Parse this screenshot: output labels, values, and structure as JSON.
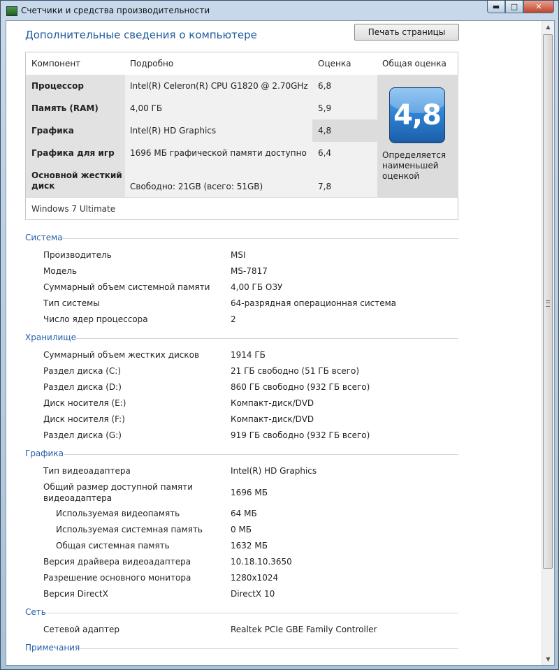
{
  "window": {
    "title": "Счетчики и средства производительности",
    "minimize": "▬",
    "maximize": "□",
    "close": "✕"
  },
  "page": {
    "heading": "Дополнительные сведения о компьютере",
    "print_button": "Печать страницы"
  },
  "score_table": {
    "headers": {
      "component": "Компонент",
      "details": "Подробно",
      "score": "Оценка",
      "base": "Общая оценка"
    },
    "rows": [
      {
        "component": "Процессор",
        "details": "Intel(R) Celeron(R) CPU G1820 @ 2.70GHz",
        "score": "6,8"
      },
      {
        "component": "Память (RAM)",
        "details": "4,00 ГБ",
        "score": "5,9"
      },
      {
        "component": "Графика",
        "details": "Intel(R) HD Graphics",
        "score": "4,8"
      },
      {
        "component": "Графика для игр",
        "details": "1696 МБ графической памяти доступно",
        "score": "6,4"
      },
      {
        "component": "Основной жесткий диск",
        "details": "Свободно: 21GB (всего: 51GB)",
        "score": "7,8"
      }
    ],
    "base_score": "4,8",
    "base_caption": "Определяется наименьшей оценкой",
    "os": "Windows 7 Ultimate"
  },
  "sections": {
    "system": {
      "title": "Система",
      "items": [
        {
          "label": "Производитель",
          "value": "MSI"
        },
        {
          "label": "Модель",
          "value": "MS-7817"
        },
        {
          "label": "Суммарный объем системной памяти",
          "value": "4,00 ГБ ОЗУ"
        },
        {
          "label": "Тип системы",
          "value": "64-разрядная операционная система"
        },
        {
          "label": "Число ядер процессора",
          "value": "2"
        }
      ]
    },
    "storage": {
      "title": "Хранилище",
      "items": [
        {
          "label": "Суммарный объем жестких дисков",
          "value": "1914 ГБ"
        },
        {
          "label": "Раздел диска (C:)",
          "value": "21 ГБ свободно (51 ГБ всего)"
        },
        {
          "label": "Раздел диска (D:)",
          "value": "860 ГБ свободно (932 ГБ всего)"
        },
        {
          "label": "Диск носителя (E:)",
          "value": "Компакт-диск/DVD"
        },
        {
          "label": "Диск носителя (F:)",
          "value": "Компакт-диск/DVD"
        },
        {
          "label": "Раздел диска (G:)",
          "value": "919 ГБ свободно (932 ГБ всего)"
        }
      ]
    },
    "graphics": {
      "title": "Графика",
      "adapter_type": {
        "label": "Тип видеоадаптера",
        "value": "Intel(R) HD Graphics"
      },
      "total_memory": {
        "label_line1": "Общий размер доступной памяти",
        "label_line2": "видеоадаптера",
        "value": "1696 МБ"
      },
      "sub_items": [
        {
          "label": "Используемая видеопамять",
          "value": "64 МБ"
        },
        {
          "label": "Используемая системная память",
          "value": "0 МБ"
        },
        {
          "label": "Общая системная память",
          "value": "1632 МБ"
        }
      ],
      "items": [
        {
          "label": "Версия драйвера видеоадаптера",
          "value": "10.18.10.3650"
        },
        {
          "label": "Разрешение основного монитора",
          "value": "1280x1024"
        },
        {
          "label": "Версия DirectX",
          "value": "DirectX 10"
        }
      ]
    },
    "network": {
      "title": "Сеть",
      "items": [
        {
          "label": "Сетевой адаптер",
          "value": "Realtek PCIe GBE Family Controller"
        }
      ]
    },
    "notes": {
      "title": "Примечания"
    }
  }
}
